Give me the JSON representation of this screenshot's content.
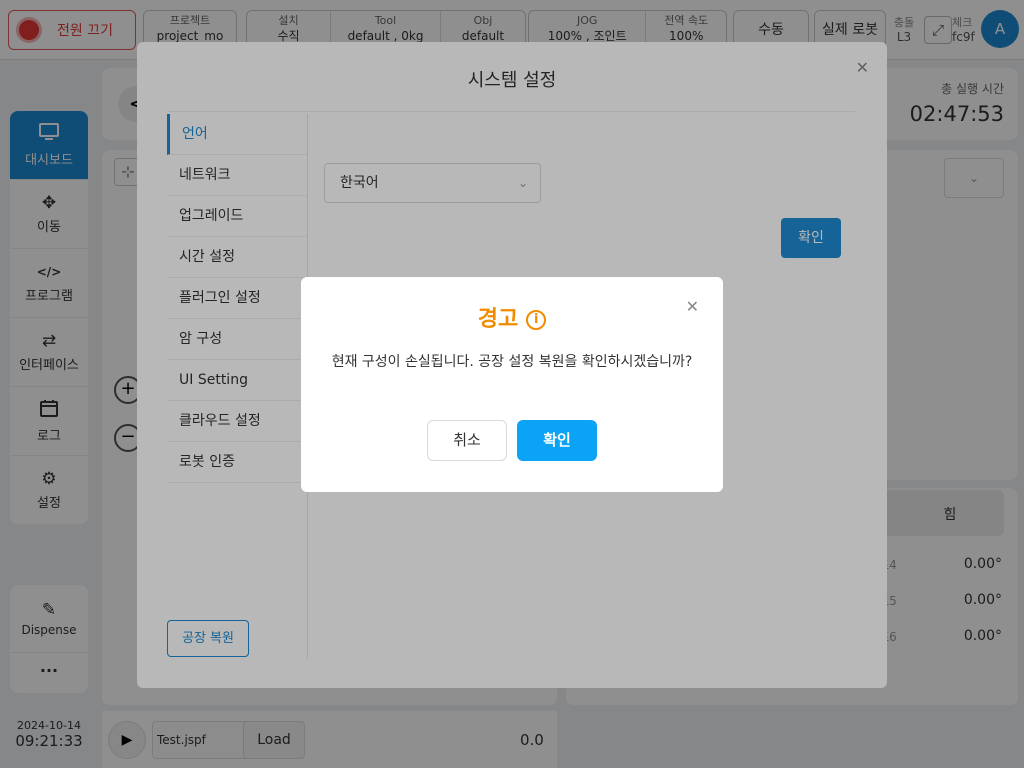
{
  "topbar": {
    "power_label": "전원 끄기",
    "project": {
      "title": "프로젝트",
      "value": "project_mo"
    },
    "install": {
      "title": "설치",
      "value": "수직"
    },
    "tool": {
      "title": "Tool",
      "value": "default , 0kg"
    },
    "obj": {
      "title": "Obj",
      "value": "default"
    },
    "jog": {
      "title": "JOG",
      "value": "100% , 조인트"
    },
    "global_speed": {
      "title": "전역 속도",
      "value": "100%"
    },
    "manual_label": "수동",
    "real_robot_label": "실제 로봇",
    "collision": {
      "title": "충돌",
      "value": "L3"
    },
    "check": {
      "title": "체크",
      "value": "fc9f"
    },
    "avatar": "A"
  },
  "sidebar": {
    "items": [
      {
        "label": "대시보드",
        "icon": "monitor-icon"
      },
      {
        "label": "이동",
        "icon": "move-icon"
      },
      {
        "label": "프로그램",
        "icon": "code-icon"
      },
      {
        "label": "인터페이스",
        "icon": "swap-icon"
      },
      {
        "label": "로그",
        "icon": "calendar-icon"
      },
      {
        "label": "설정",
        "icon": "gear-icon"
      }
    ],
    "dispense_label": "Dispense",
    "more_label": "···"
  },
  "datetime": {
    "date": "2024-10-14",
    "time": "09:21:33"
  },
  "runtime": {
    "label": "총 실행 시간",
    "value": "02:47:53"
  },
  "joints": {
    "header": "힘",
    "rows": [
      {
        "label": "조인트4",
        "value": "0.00°"
      },
      {
        "label": "조인트5",
        "value": "0.00°"
      },
      {
        "label": "조인트6",
        "value": "0.00°"
      }
    ]
  },
  "player": {
    "file": "Test.jspf",
    "load_label": "Load",
    "speed": "0.0"
  },
  "system_settings": {
    "title": "시스템 설정",
    "menu": [
      "언어",
      "네트워크",
      "업그레이드",
      "시간 설정",
      "플러그인 설정",
      "암 구성",
      "UI Setting",
      "클라우드 설정",
      "로봇 인증"
    ],
    "language_value": "한국어",
    "confirm_label": "확인",
    "factory_reset_label": "공장 복원"
  },
  "warning_dialog": {
    "title": "경고",
    "message": "현재 구성이 손실됩니다. 공장 설정 복원을 확인하시겠습니까?",
    "cancel_label": "취소",
    "ok_label": "확인"
  },
  "colors": {
    "accent": "#1e8ad2",
    "warning": "#f08c00",
    "ok_button": "#0aa3f5",
    "power": "#e53935"
  }
}
